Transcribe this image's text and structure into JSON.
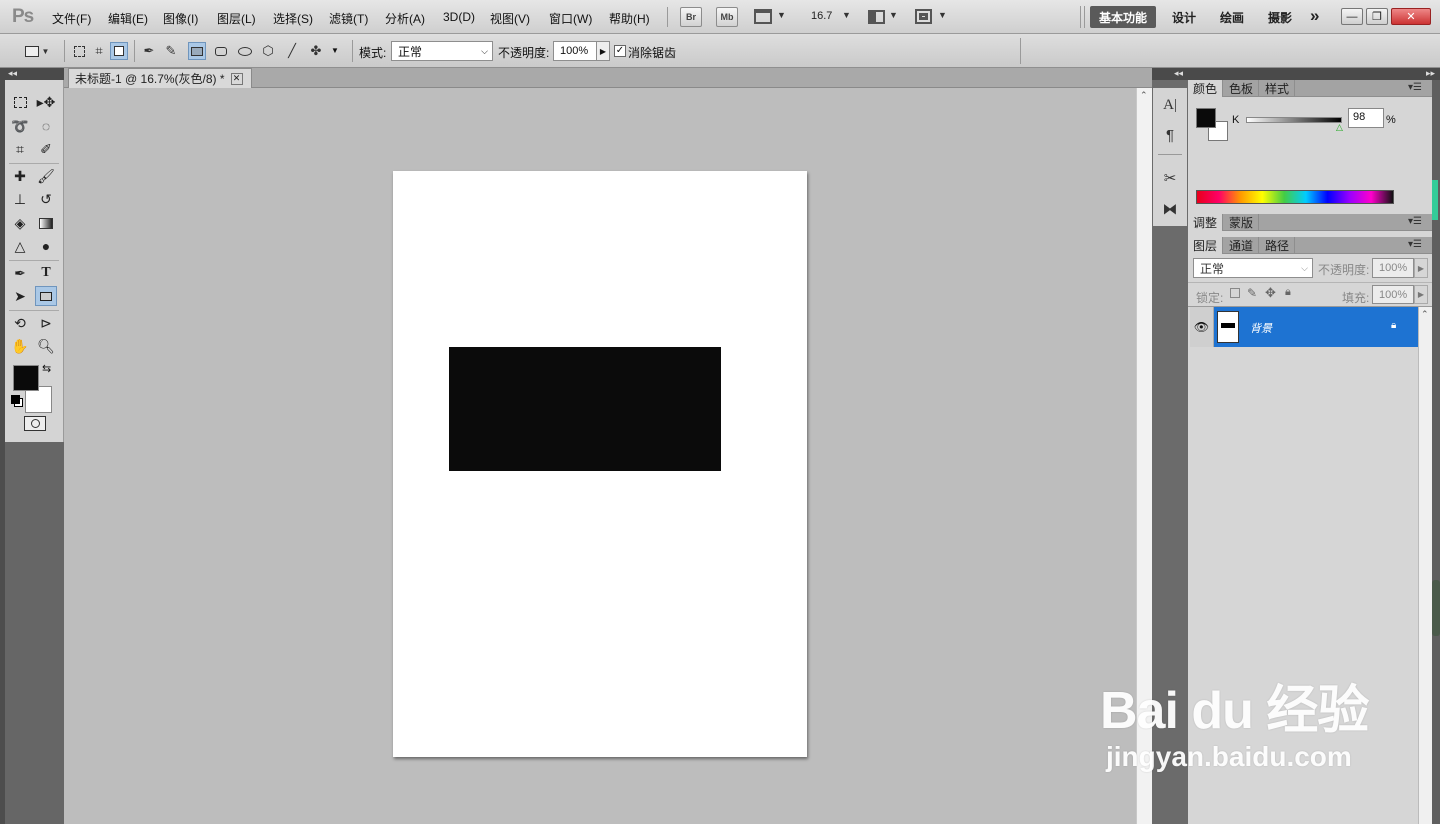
{
  "app": {
    "logo": "Ps"
  },
  "menu": [
    "文件(F)",
    "编辑(E)",
    "图像(I)",
    "图层(L)",
    "选择(S)",
    "滤镜(T)",
    "分析(A)",
    "3D(D)",
    "视图(V)",
    "窗口(W)",
    "帮助(H)"
  ],
  "menubar_buttons": {
    "br": "Br",
    "mb": "Mb",
    "zoom": "16.7"
  },
  "workspaces": {
    "active": "基本功能",
    "items": [
      "设计",
      "绘画",
      "摄影"
    ],
    "more": "»"
  },
  "window_controls": {
    "min": "—",
    "restore": "❐",
    "close": "✕"
  },
  "options": {
    "mode_label": "模式:",
    "mode_value": "正常",
    "opacity_label": "不透明度:",
    "opacity_value": "100%",
    "antialias_label": "消除锯齿",
    "antialias_checked": true
  },
  "document": {
    "tab_title": "未标题-1 @ 16.7%(灰色/8) *",
    "close": "✕",
    "canvas_color": "#ffffff",
    "shape_color": "#0b0b0b"
  },
  "color_panel": {
    "tabs": [
      "颜色",
      "色板",
      "样式"
    ],
    "channel_label": "K",
    "channel_value": "98",
    "percent": "%",
    "foreground": "#0a0a0a",
    "background": "#ffffff"
  },
  "adjust_panel": {
    "tabs": [
      "调整",
      "蒙版"
    ]
  },
  "layers_panel": {
    "tabs": [
      "图层",
      "通道",
      "路径"
    ],
    "blend_mode": "正常",
    "opacity_label": "不透明度:",
    "opacity_value": "100%",
    "lock_label": "锁定:",
    "fill_label": "填充:",
    "fill_value": "100%",
    "layers": [
      {
        "name": "背景",
        "visible": true,
        "locked": true,
        "selected": true
      }
    ]
  },
  "watermark": {
    "text": "Bai du 经验",
    "url": "jingyan.baidu.com"
  }
}
